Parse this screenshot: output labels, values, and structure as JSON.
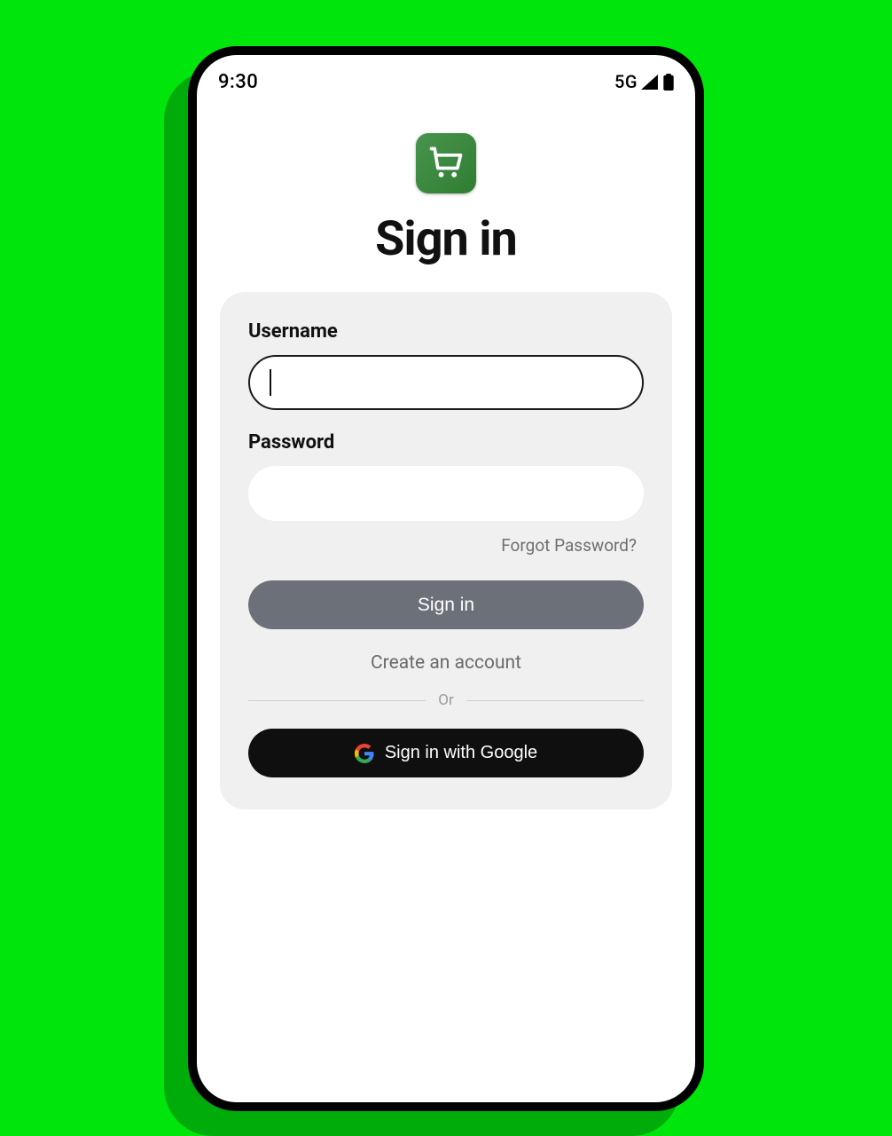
{
  "status_bar": {
    "time": "9:30",
    "network": "5G"
  },
  "logo": {
    "icon_name": "cart-icon"
  },
  "page": {
    "title": "Sign in"
  },
  "form": {
    "username_label": "Username",
    "username_value": "",
    "password_label": "Password",
    "password_value": "",
    "forgot_password": "Forgot Password?",
    "signin_button": "Sign in",
    "create_account": "Create an account",
    "divider": "Or",
    "google_signin": "Sign in with Google"
  },
  "colors": {
    "background": "#00e60c",
    "logo_bg": "#3b8a3f",
    "card_bg": "#f1f0f0",
    "primary_btn": "#6c7179",
    "google_btn": "#0f0f0f"
  }
}
